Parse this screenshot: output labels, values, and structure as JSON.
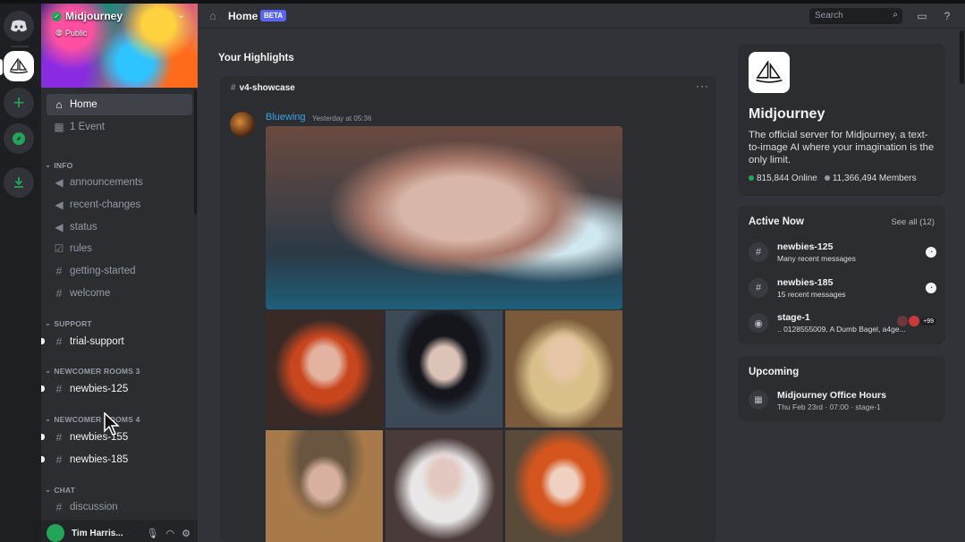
{
  "colors": {
    "accent": "#5865f2",
    "online": "#23a559",
    "link": "#3aa3e6",
    "members": "#949ba4"
  },
  "server": {
    "name": "Midjourney",
    "visibility": "Public"
  },
  "sidebar": {
    "top_items": [
      {
        "label": "Home",
        "icon": "home-icon"
      },
      {
        "label": "1 Event",
        "icon": "calendar-icon"
      }
    ],
    "categories": [
      {
        "label": "INFO",
        "channels": [
          {
            "label": "announcements",
            "icon": "megaphone-icon"
          },
          {
            "label": "recent-changes",
            "icon": "megaphone-icon"
          },
          {
            "label": "status",
            "icon": "megaphone-icon"
          },
          {
            "label": "rules",
            "icon": "checkbox-icon"
          },
          {
            "label": "getting-started",
            "icon": "hash-icon"
          },
          {
            "label": "welcome",
            "icon": "hash-icon"
          }
        ]
      },
      {
        "label": "SUPPORT",
        "channels": [
          {
            "label": "trial-support",
            "icon": "hash-icon"
          }
        ]
      },
      {
        "label": "NEWCOMER ROOMS 3",
        "channels": [
          {
            "label": "newbies-125",
            "icon": "hash-thread-icon"
          }
        ]
      },
      {
        "label": "NEWCOMER ROOMS 4",
        "channels": [
          {
            "label": "newbies-155",
            "icon": "hash-thread-icon"
          },
          {
            "label": "newbies-185",
            "icon": "hash-thread-icon"
          }
        ]
      },
      {
        "label": "CHAT",
        "channels": [
          {
            "label": "discussion",
            "icon": "hash-icon"
          }
        ]
      }
    ],
    "user": {
      "name": "Tim Harris..."
    }
  },
  "topbar": {
    "title": "Home",
    "badge": "BETA",
    "search_placeholder": "Search"
  },
  "highlights": {
    "heading": "Your Highlights",
    "channel": "v4-showcase",
    "author": "Bluewing",
    "timestamp": "Yesterday at 05:36"
  },
  "about": {
    "title": "Midjourney",
    "description": "The official server for Midjourney, a text-to-image AI where your imagination is the only limit.",
    "online": "815,844 Online",
    "members": "11,366,494 Members"
  },
  "active_now": {
    "title": "Active Now",
    "see_all": "See all (12)",
    "items": [
      {
        "name": "newbies-125",
        "sub": "Many recent messages",
        "icon": "hash-icon"
      },
      {
        "name": "newbies-185",
        "sub": "15 recent messages",
        "icon": "hash-icon"
      },
      {
        "name": "stage-1",
        "sub": ".. 0128555009, A Dumb Bagel, a4ge...",
        "icon": "stage-icon",
        "extra": "+99"
      }
    ]
  },
  "upcoming": {
    "title": "Upcoming",
    "event_name": "Midjourney Office Hours",
    "event_meta": "Thu Feb 23rd · 07:00 · stage-1"
  }
}
